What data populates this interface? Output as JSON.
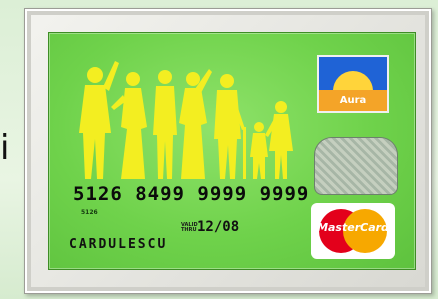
{
  "stray_text": "i",
  "card": {
    "issuer_logo_text": "Aura",
    "number": "5126 8499 9999 9999",
    "number_small": "5126",
    "valid_label": "VALID THRU",
    "expiry": "12/08",
    "holder_name": "CARDULESCU",
    "network_logo_text": "MasterCard",
    "colors": {
      "card_green": "#6fd24b",
      "silhouette_yellow": "#f3ee21",
      "mastercard_red": "#e3001b",
      "mastercard_yellow": "#f7a800",
      "aura_blue": "#1f63d6",
      "aura_orange": "#f4a428"
    }
  }
}
